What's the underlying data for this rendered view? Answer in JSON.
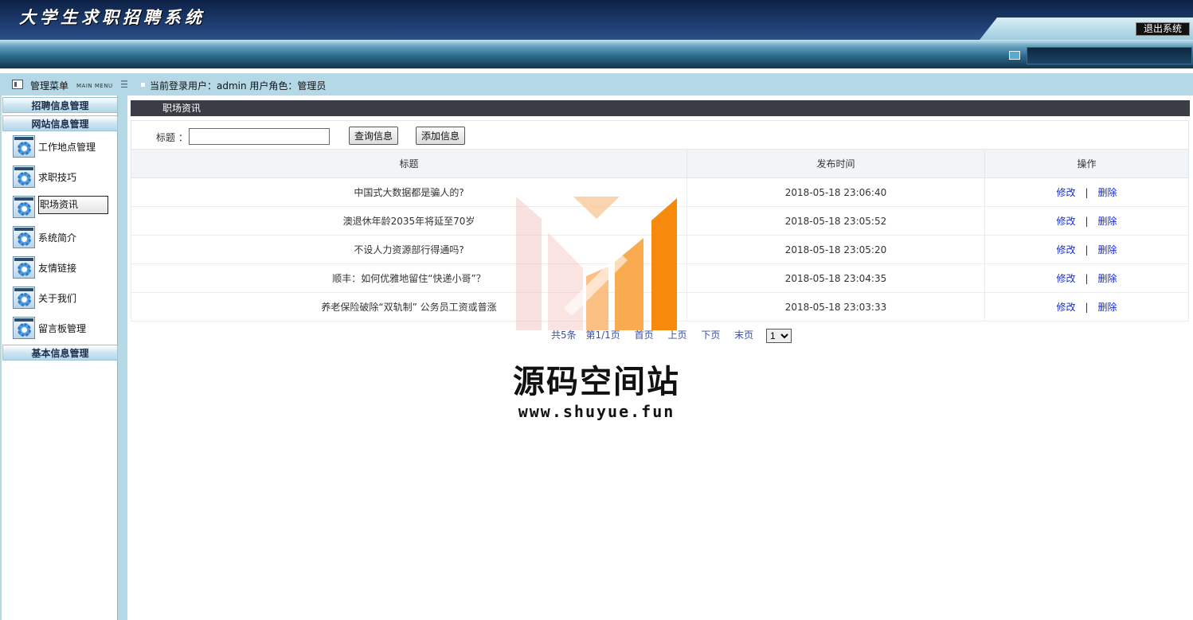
{
  "header": {
    "app_title": "大学生求职招聘系统",
    "logout_label": "退出系统"
  },
  "sidebar": {
    "title": "管理菜单",
    "subtitle": "MAIN MENU",
    "groups": [
      {
        "label": "招聘信息管理"
      },
      {
        "label": "网站信息管理"
      },
      {
        "label": "基本信息管理"
      }
    ],
    "items": [
      {
        "label": "工作地点管理"
      },
      {
        "label": "求职技巧"
      },
      {
        "label": "职场资讯",
        "active": true
      },
      {
        "label": "系统简介"
      },
      {
        "label": "友情链接"
      },
      {
        "label": "关于我们"
      },
      {
        "label": "留言板管理"
      }
    ]
  },
  "userbar": {
    "text": "当前登录用户：admin  用户角色：管理员"
  },
  "main": {
    "section_title": "职场资讯",
    "search": {
      "label": "标题 ：",
      "value": "",
      "query_button": "查询信息",
      "add_button": "添加信息"
    },
    "table": {
      "columns": [
        "标题",
        "发布时间",
        "操作"
      ],
      "rows": [
        {
          "title": "中国式大数据都是骗人的?",
          "time": "2018-05-18 23:06:40",
          "edit": "修改",
          "sep": "|",
          "delete": "删除"
        },
        {
          "title": "澳退休年龄2035年将延至70岁",
          "time": "2018-05-18 23:05:52",
          "edit": "修改",
          "sep": "|",
          "delete": "删除"
        },
        {
          "title": "不设人力资源部行得通吗?",
          "time": "2018-05-18 23:05:20",
          "edit": "修改",
          "sep": "|",
          "delete": "删除"
        },
        {
          "title": "顺丰：如何优雅地留住“快递小哥”？",
          "time": "2018-05-18 23:04:35",
          "edit": "修改",
          "sep": "|",
          "delete": "删除"
        },
        {
          "title": "养老保险破除“双轨制” 公务员工资或普涨",
          "time": "2018-05-18 23:03:33",
          "edit": "修改",
          "sep": "|",
          "delete": "删除"
        }
      ]
    },
    "pager": {
      "total": "共5条",
      "page_info": "第1/1页",
      "first": "首页",
      "prev": "上页",
      "next": "下页",
      "last": "末页",
      "selected_page": "1"
    }
  },
  "watermark": {
    "text": "源码空间站",
    "url": "www.shuyue.fun"
  },
  "colors": {
    "header_dark": "#0e2247",
    "sidebar_bg": "#b5d8e6",
    "section_bar": "#3a3d45",
    "link": "#1a2dc3",
    "watermark_orange": "#f78a0c"
  }
}
